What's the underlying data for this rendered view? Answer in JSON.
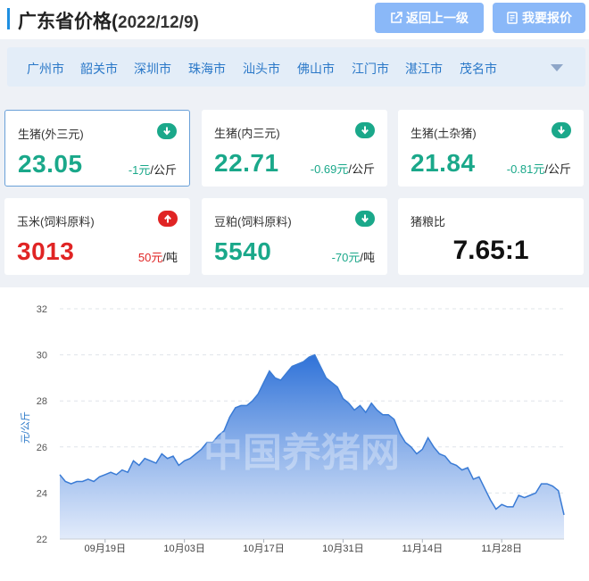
{
  "header": {
    "title": "广东省价格(",
    "date": "2022/12/9)",
    "back_label": "返回上一级",
    "report_label": "我要报价"
  },
  "cities": [
    "广州市",
    "韶关市",
    "深圳市",
    "珠海市",
    "汕头市",
    "佛山市",
    "江门市",
    "湛江市",
    "茂名市"
  ],
  "cards": [
    {
      "label": "生猪(外三元)",
      "value": "23.05",
      "change": "-1元",
      "unit": "/公斤",
      "direction": "down",
      "color": "#1aa88a"
    },
    {
      "label": "生猪(内三元)",
      "value": "22.71",
      "change": "-0.69元",
      "unit": "/公斤",
      "direction": "down",
      "color": "#1aa88a"
    },
    {
      "label": "生猪(土杂猪)",
      "value": "21.84",
      "change": "-0.81元",
      "unit": "/公斤",
      "direction": "down",
      "color": "#1aa88a"
    },
    {
      "label": "玉米(饲料原料)",
      "value": "3013",
      "change": "50元",
      "unit": "/吨",
      "direction": "up",
      "color": "#e02424"
    },
    {
      "label": "豆粕(饲料原料)",
      "value": "5540",
      "change": "-70元",
      "unit": "/吨",
      "direction": "down",
      "color": "#1aa88a"
    }
  ],
  "ratio": {
    "label": "猪粮比",
    "value": "7.65:1"
  },
  "watermark": "中国养猪网",
  "chart_data": {
    "type": "area",
    "ylabel": "元/公斤",
    "ylim": [
      22,
      32
    ],
    "yticks": [
      22,
      24,
      26,
      28,
      30,
      32
    ],
    "xticks": [
      "09月19日",
      "10月03日",
      "10月17日",
      "10月31日",
      "11月14日",
      "11月28日"
    ],
    "xtick_index": [
      8,
      22,
      36,
      50,
      64,
      78
    ],
    "x_start": "09月11日",
    "color": "#3a7bd5",
    "grid": true,
    "values": [
      24.8,
      24.5,
      24.4,
      24.5,
      24.5,
      24.6,
      24.5,
      24.7,
      24.8,
      24.9,
      24.8,
      25.0,
      24.9,
      25.4,
      25.2,
      25.5,
      25.4,
      25.3,
      25.7,
      25.5,
      25.6,
      25.2,
      25.4,
      25.5,
      25.7,
      25.9,
      26.2,
      26.2,
      26.5,
      26.7,
      27.3,
      27.7,
      27.8,
      27.8,
      28.0,
      28.3,
      28.8,
      29.3,
      29.0,
      28.9,
      29.2,
      29.5,
      29.6,
      29.7,
      29.9,
      30.0,
      29.5,
      29.0,
      28.8,
      28.6,
      28.1,
      27.9,
      27.6,
      27.8,
      27.5,
      27.9,
      27.6,
      27.4,
      27.4,
      27.2,
      26.6,
      26.2,
      26.0,
      25.7,
      25.9,
      26.4,
      26.0,
      25.7,
      25.6,
      25.3,
      25.2,
      25.0,
      25.1,
      24.6,
      24.7,
      24.2,
      23.7,
      23.3,
      23.5,
      23.4,
      23.4,
      23.9,
      23.8,
      23.9,
      24.0,
      24.4,
      24.4,
      24.3,
      24.1,
      23.05
    ]
  }
}
